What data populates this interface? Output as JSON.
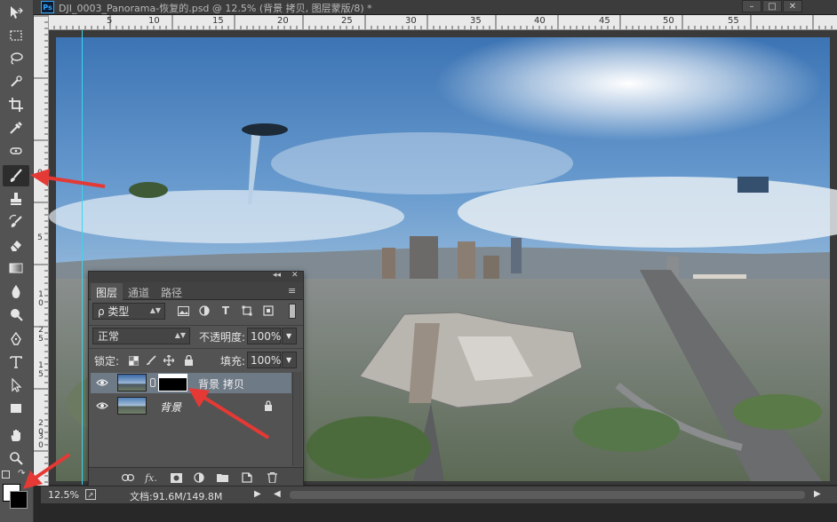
{
  "window": {
    "tab_title": "DJI_0003_Panorama-恢复的.psd @ 12.5% (背景 拷贝, 图层蒙版/8) *",
    "ps_logo": "Ps",
    "minimize": "–",
    "restore": "□",
    "close": "✕"
  },
  "ruler": {
    "top_labels": [
      "5",
      "10",
      "15",
      "20",
      "25",
      "30",
      "35",
      "40",
      "45",
      "50",
      "55"
    ],
    "left_labels": [
      "0",
      "5",
      "1 0",
      "1 5",
      "2 0",
      "2 5",
      "3 0"
    ]
  },
  "layers_panel": {
    "collapse": "◂◂",
    "close": "✕",
    "menu": "≡",
    "tabs": [
      "图层",
      "通道",
      "路径"
    ],
    "filter_kind": "ρ 类型",
    "blend_mode": "正常",
    "opacity_label": "不透明度:",
    "opacity_value": "100%",
    "lock_label": "锁定:",
    "fill_label": "填充:",
    "fill_value": "100%",
    "layers": [
      {
        "name": "背景 拷贝",
        "selected": true
      },
      {
        "name": "背景",
        "selected": false
      }
    ],
    "footer_buttons": [
      "link-layers",
      "fx",
      "add-mask",
      "adjustment",
      "group",
      "new-layer",
      "delete"
    ]
  },
  "status": {
    "zoom": "12.5%",
    "doc_info": "文档:91.6M/149.8M"
  },
  "colors": {
    "foreground": "#ffffff",
    "background": "#000000",
    "annotation_arrow": "#e53935",
    "guide": "#39d6ee"
  }
}
